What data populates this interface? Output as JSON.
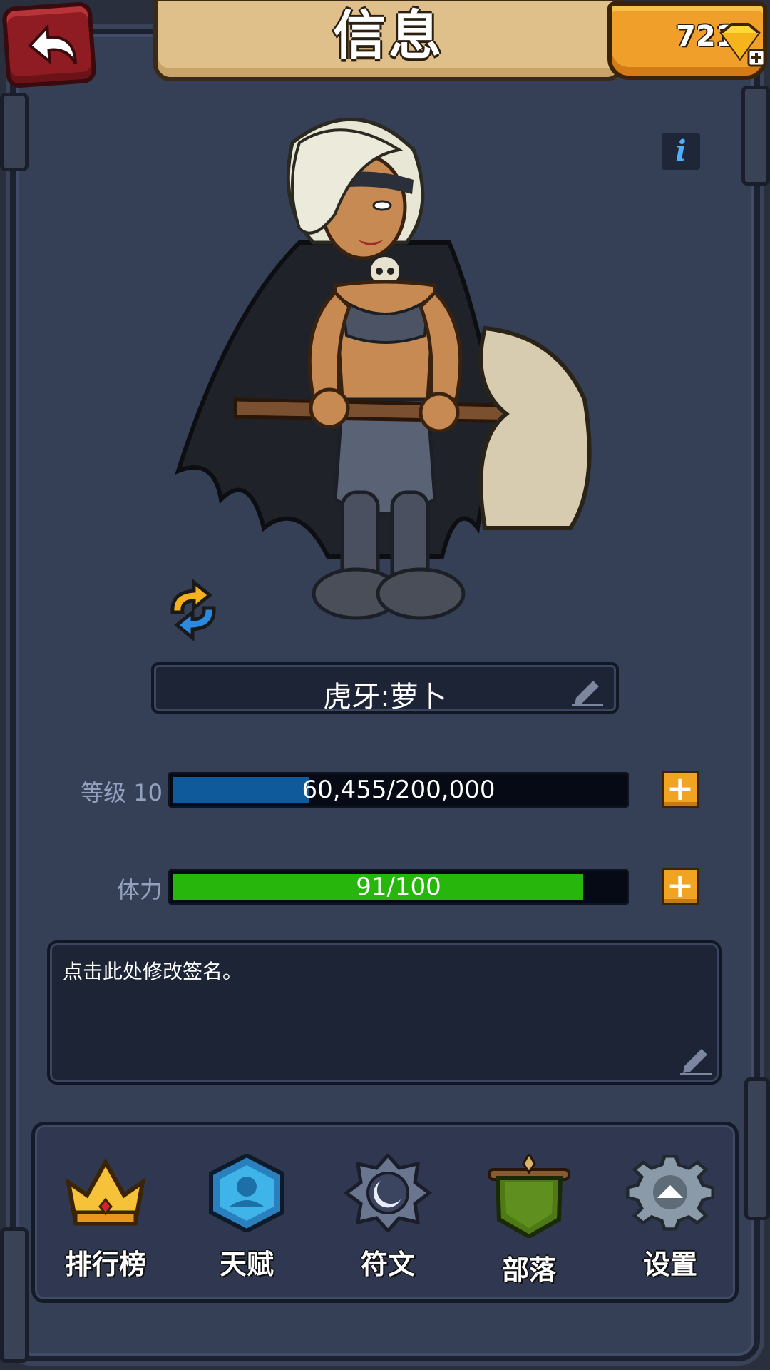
{
  "header": {
    "title": "信息",
    "gems": "721"
  },
  "player": {
    "name": "虎牙:萝卜"
  },
  "stats": {
    "level_label": "等级 10",
    "xp_text": "60,455/200,000",
    "xp_fraction": 0.302,
    "stamina_label": "体力",
    "stamina_text": "91/100",
    "stamina_fraction": 0.91
  },
  "signature": {
    "placeholder": "点击此处修改签名。"
  },
  "nav": {
    "items": [
      {
        "label": "排行榜",
        "icon": "crown-icon"
      },
      {
        "label": "天赋",
        "icon": "talent-icon"
      },
      {
        "label": "符文",
        "icon": "rune-icon"
      },
      {
        "label": "部落",
        "icon": "tribe-banner-icon"
      },
      {
        "label": "设置",
        "icon": "settings-gear-icon"
      }
    ]
  },
  "colors": {
    "xp_bar": "#0f5a9a",
    "stamina_bar": "#27b60c",
    "accent_orange": "#f0a422",
    "panel": "#354057"
  }
}
